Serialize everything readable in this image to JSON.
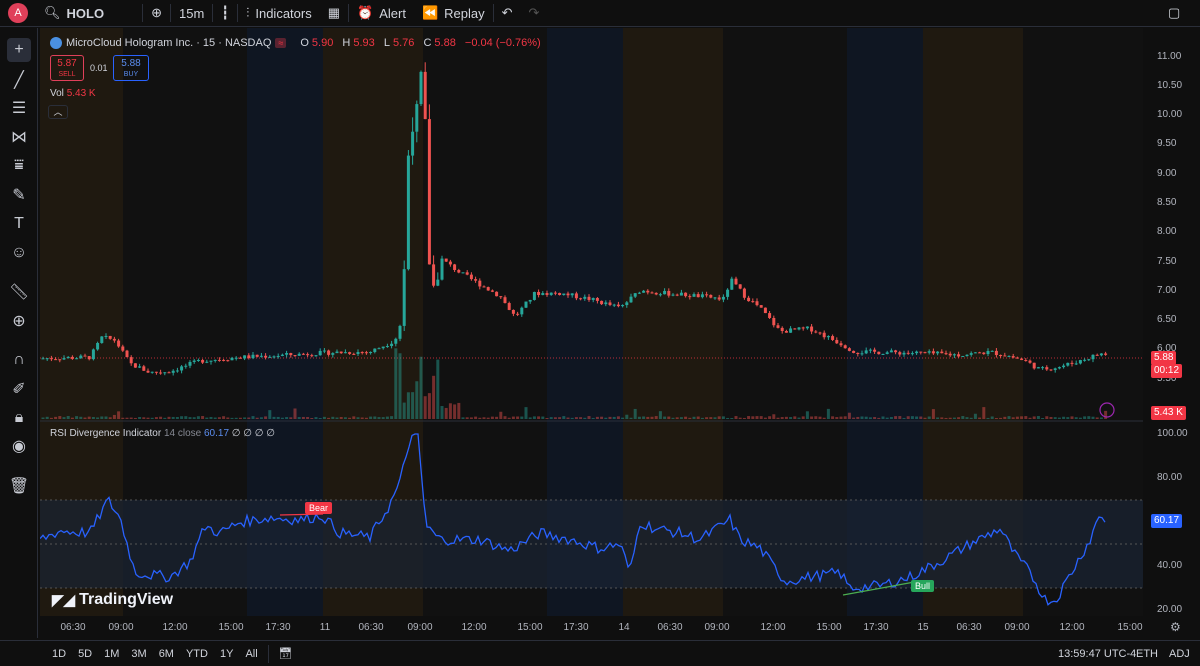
{
  "toolbar": {
    "avatar": "A",
    "symbol": "HOLO",
    "interval": "15m",
    "indicators": "Indicators",
    "alert": "Alert",
    "replay": "Replay"
  },
  "legend": {
    "title": "MicroCloud Hologram Inc. · 15 · NASDAQ",
    "o_label": "O",
    "o": "5.90",
    "h_label": "H",
    "h": "5.93",
    "l_label": "L",
    "l": "5.76",
    "c_label": "C",
    "c": "5.88",
    "change": "−0.04 (−0.76%)",
    "sell_price": "5.87",
    "sell_label": "SELL",
    "spread": "0.01",
    "buy_price": "5.88",
    "buy_label": "BUY",
    "vol_label": "Vol",
    "vol_value": "5.43 K",
    "rsi_label": "RSI Divergence Indicator",
    "rsi_params": "14 close",
    "rsi_value": "60.17",
    "rsi_extra": "∅ ∅ ∅ ∅"
  },
  "price_axis": [
    "11.00",
    "10.50",
    "10.00",
    "9.50",
    "9.00",
    "8.50",
    "8.00",
    "7.50",
    "7.00",
    "6.50",
    "6.00",
    "5.50"
  ],
  "price_tags": {
    "price": "5.88",
    "countdown": "00:12",
    "vol": "5.43 K",
    "rsi": "60.17"
  },
  "rsi_axis": [
    "100.00",
    "80.00",
    "60.00",
    "40.00",
    "20.00"
  ],
  "labels": {
    "bear": "Bear",
    "bull": "Bull"
  },
  "time_axis": [
    "06:30",
    "09:00",
    "12:00",
    "15:00",
    "17:30",
    "11",
    "06:30",
    "09:00",
    "12:00",
    "15:00",
    "17:30",
    "14",
    "06:30",
    "09:00",
    "12:00",
    "15:00",
    "17:30",
    "15",
    "06:30",
    "09:00",
    "12:00",
    "15:00"
  ],
  "ranges": [
    "1D",
    "5D",
    "1M",
    "3M",
    "6M",
    "YTD",
    "1Y",
    "All"
  ],
  "status": {
    "time": "13:59:47 UTC-4",
    "session": "ETH",
    "adj": "ADJ"
  },
  "brand": "TradingView",
  "colors": {
    "up": "#26a69a",
    "down": "#ef5350",
    "rsi": "#2962ff",
    "bg": "#0f0f0f"
  }
}
